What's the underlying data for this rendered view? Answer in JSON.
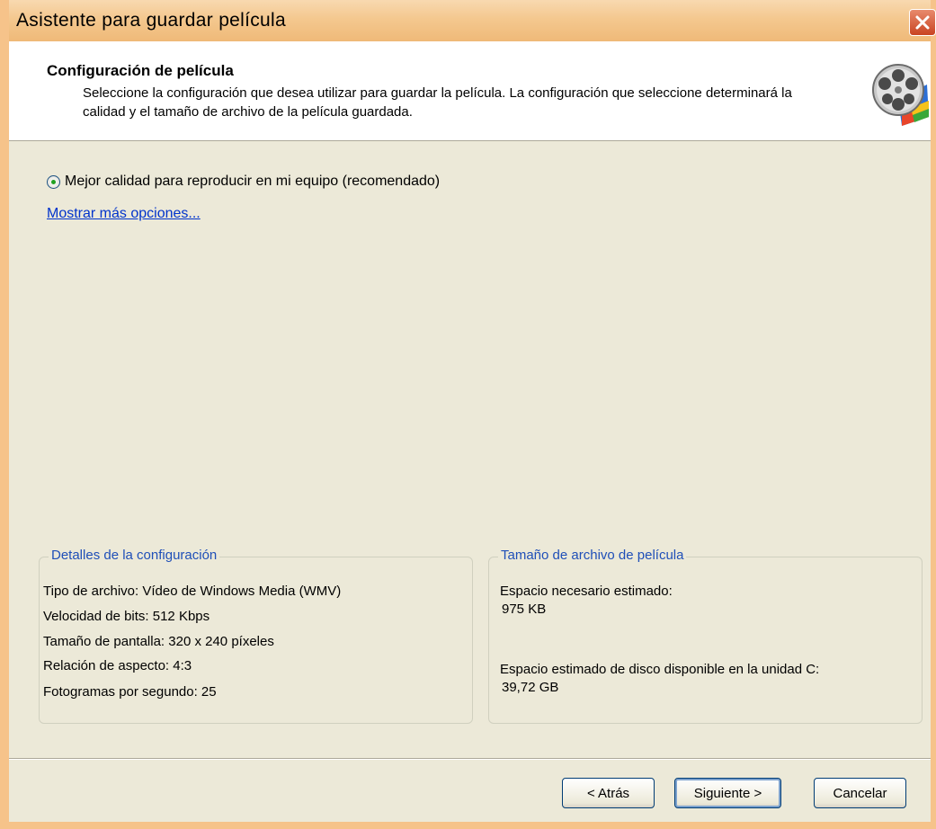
{
  "window": {
    "title": "Asistente para guardar película",
    "close_icon": "close-icon",
    "colors": {
      "frame": "#f6c38a",
      "body": "#ece9d8",
      "accent_link": "#0033cc",
      "group_title": "#1f4fb8"
    }
  },
  "header": {
    "title": "Configuración de película",
    "description": "Seleccione la configuración que desea utilizar para guardar la película. La configuración que seleccione determinará la calidad y el tamaño de archivo de la película guardada.",
    "icon": "film-reel-icon"
  },
  "options": {
    "selected_label": "Mejor calidad para reproducir en mi equipo (recomendado)",
    "more_link": "Mostrar más opciones..."
  },
  "details": {
    "title": "Detalles de la configuración",
    "lines": [
      "Tipo de archivo: Vídeo de Windows Media (WMV)",
      "Velocidad de bits: 512 Kbps",
      "Tamaño de pantalla: 320 x 240 píxeles",
      "Relación de aspecto: 4:3",
      "Fotogramas por segundo: 25"
    ]
  },
  "file_size": {
    "title": "Tamaño de archivo de película",
    "estimated_label": "Espacio necesario estimado:",
    "estimated_value": "975 KB",
    "disk_label": "Espacio estimado de disco disponible en la unidad C:",
    "disk_value": "39,72 GB"
  },
  "buttons": {
    "back": "< Atrás",
    "next": "Siguiente >",
    "cancel": "Cancelar"
  }
}
